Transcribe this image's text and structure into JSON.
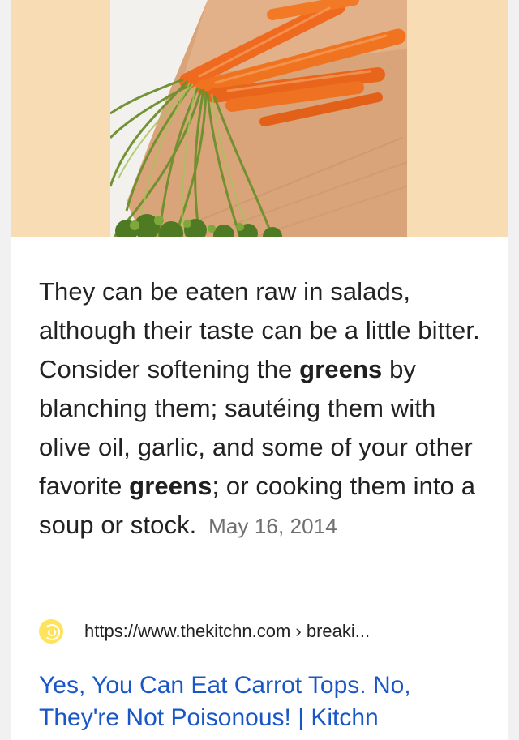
{
  "result": {
    "snippet": {
      "part1": "They can be eaten raw in salads, although their taste can be a little bitter. Consider softening the ",
      "bold1": "greens",
      "part2": " by blanching them; sautéing them with olive oil, garlic, and some of your other favorite ",
      "bold2": "greens",
      "part3": "; or cooking them into a soup or stock.",
      "date": "May 16, 2014"
    },
    "source": {
      "url": "https://www.thekitchn.com › breaki...",
      "favicon": "thekitchn-logo-icon"
    },
    "title": "Yes, You Can Eat Carrot Tops. No, They're Not Poisonous! | Kitchn"
  },
  "colors": {
    "hero_background": "#f8dcb4",
    "link": "#1a57c6",
    "date": "#6f6f6f",
    "favicon": "#ffe35a"
  }
}
